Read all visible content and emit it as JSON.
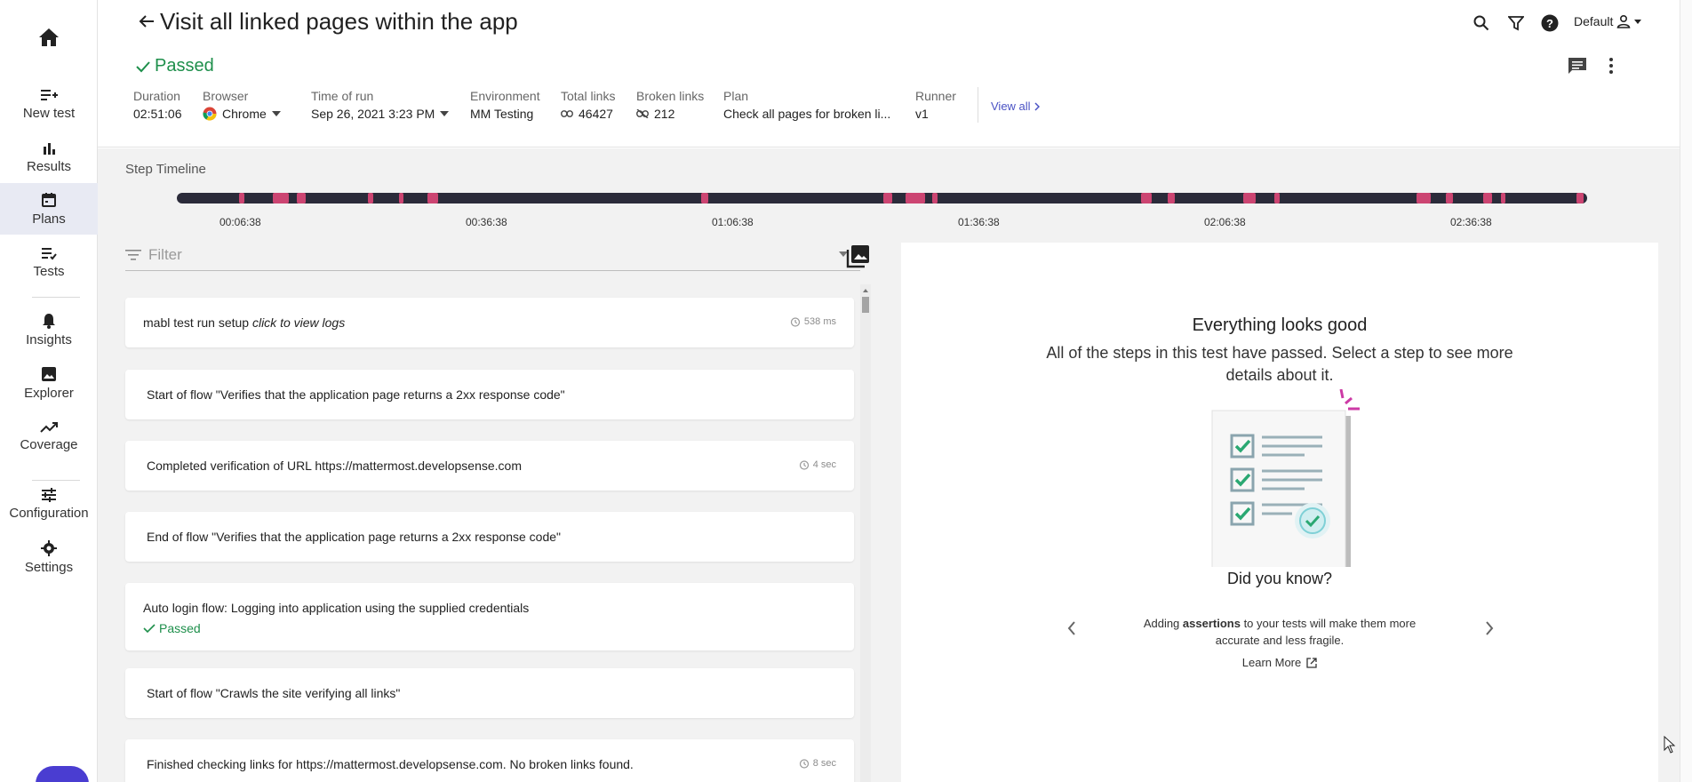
{
  "nav": {
    "items": [
      {
        "name": "new-test",
        "label": "New test"
      },
      {
        "name": "results",
        "label": "Results"
      },
      {
        "name": "plans",
        "label": "Plans"
      },
      {
        "name": "tests",
        "label": "Tests"
      },
      {
        "name": "insights",
        "label": "Insights"
      },
      {
        "name": "explorer",
        "label": "Explorer"
      },
      {
        "name": "coverage",
        "label": "Coverage"
      },
      {
        "name": "configuration",
        "label": "Configuration"
      },
      {
        "name": "settings",
        "label": "Settings"
      }
    ],
    "active": "Plans"
  },
  "header": {
    "title": "Visit all linked pages within the app",
    "status": "Passed",
    "workspace": "Default",
    "meta": {
      "duration_label": "Duration",
      "duration": "02:51:06",
      "browser_label": "Browser",
      "browser": "Chrome",
      "time_label": "Time of run",
      "time": "Sep 26, 2021 3:23 PM",
      "env_label": "Environment",
      "env": "MM Testing",
      "total_links_label": "Total links",
      "total_links": "46427",
      "broken_links_label": "Broken links",
      "broken_links": "212",
      "plan_label": "Plan",
      "plan": "Check all pages for broken li...",
      "runner_label": "Runner",
      "runner": "v1"
    },
    "view_all": "View all"
  },
  "timeline": {
    "label": "Step Timeline",
    "ticks": [
      "00:06:38",
      "00:36:38",
      "01:06:38",
      "01:36:38",
      "02:06:38",
      "02:36:38"
    ]
  },
  "filter": {
    "placeholder": "Filter"
  },
  "steps": [
    {
      "text": "mabl test run setup",
      "italic": "click to view logs",
      "duration": "538 ms"
    },
    {
      "text": "Start of flow \"Verifies that the application page returns a 2xx response code\"",
      "duration": ""
    },
    {
      "text": "Completed verification of URL https://mattermost.developsense.com",
      "duration": "4 sec"
    },
    {
      "text": "End of flow \"Verifies that the application page returns a 2xx response code\"",
      "duration": ""
    },
    {
      "text": "Auto login flow: Logging into application using the supplied credentials",
      "status": "Passed",
      "duration": ""
    },
    {
      "text": "Start of flow \"Crawls the site verifying all links\"",
      "duration": ""
    },
    {
      "text": "Finished checking links for https://mattermost.developsense.com. No broken links found.",
      "duration": "8 sec"
    }
  ],
  "panel": {
    "heading": "Everything looks good",
    "message": "All of the steps in this test have passed. Select a step to see more details about it.",
    "did_you_know": "Did you know?",
    "tip_pre": "Adding ",
    "tip_bold": "assertions",
    "tip_post": " to your tests will make them more accurate and less fragile.",
    "learn_more": "Learn More"
  },
  "colors": {
    "accent": "#4a52c4",
    "success": "#1e8f4b",
    "timeline_dark": "#2b2b3a",
    "timeline_mark": "#e94a7c"
  }
}
